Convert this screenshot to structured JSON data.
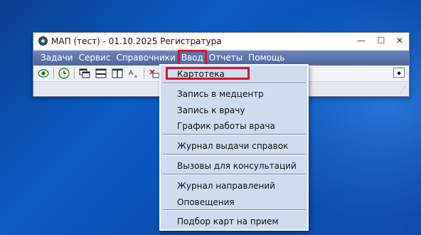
{
  "window": {
    "title": "МАП (тест) - 01.10.2025 Регистратура",
    "controls": {
      "minimize": "—",
      "maximize": "☐",
      "close": "✕"
    }
  },
  "menubar": {
    "items": [
      {
        "label": "Задачи"
      },
      {
        "label": "Сервис"
      },
      {
        "label": "Справочники"
      },
      {
        "label": "Ввод",
        "active": true
      },
      {
        "label": "Отчеты"
      },
      {
        "label": "Помощь"
      }
    ]
  },
  "toolbar": {
    "icons": [
      "eye-icon",
      "clock-icon",
      "windows-icon",
      "split-horizontal-icon",
      "split-vertical-icon",
      "font-size-icon",
      "delete-icon"
    ],
    "combo_arrow": "⬥"
  },
  "dropdown": {
    "items": [
      {
        "label": "Картотека",
        "highlighted": true
      },
      {
        "label": "Запись в медцентр"
      },
      {
        "label": "Запись к врачу"
      },
      {
        "label": "График работы врача"
      },
      {
        "label": "Журнал выдачи справок"
      },
      {
        "label": "Вызовы для консультаций"
      },
      {
        "label": "Журнал направлений"
      },
      {
        "label": "Оповещения"
      },
      {
        "label": "Подбор карт на прием"
      }
    ]
  },
  "colors": {
    "desktop": "#0c5cc4",
    "menubar": "#5a72ad",
    "dropdown": "#cfdcef",
    "highlight": "#e0102a"
  }
}
